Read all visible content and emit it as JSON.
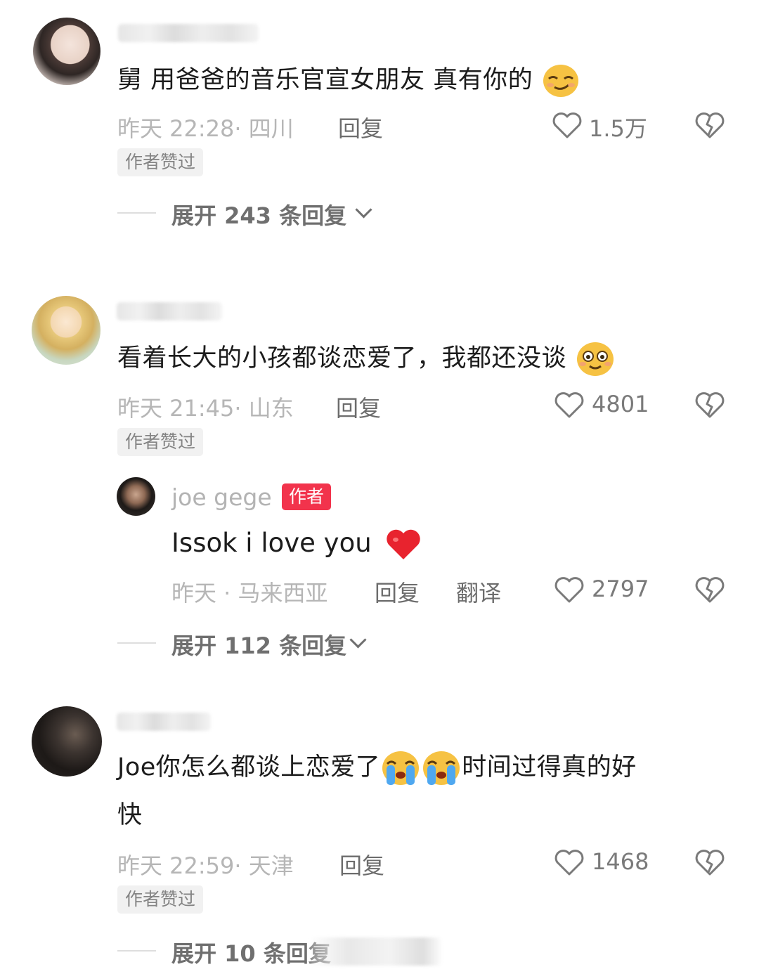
{
  "comments": [
    {
      "text": "舅 用爸爸的音乐官宣女朋友 真有你的",
      "meta": "昨天 22:28· 四川",
      "reply_label": "回复",
      "likes": "1.5万",
      "badge": "作者赞过",
      "expand": "展开 243 条回复",
      "emoji": "smirk-face"
    },
    {
      "text": "看着长大的小孩都谈恋爱了，我都还没谈",
      "meta": "昨天 21:45· 山东",
      "reply_label": "回复",
      "likes": "4801",
      "badge": "作者赞过",
      "emoji": "blushing-face",
      "author_reply": {
        "name": "joe gege",
        "tag": "作者",
        "text": "Issok i love you",
        "meta": "昨天 · 马来西亚",
        "reply_label": "回复",
        "translate_label": "翻译",
        "likes": "2797",
        "emoji": "red-heart"
      },
      "expand": "展开 112 条回复"
    },
    {
      "text_line1_a": "Joe你怎么都谈上恋爱了",
      "text_line1_b": "时间过得真的好",
      "text_line2": "快",
      "meta": "昨天 22:59· 天津",
      "reply_label": "回复",
      "likes": "1468",
      "badge": "作者赞过",
      "expand": "展开 10 条回复",
      "emoji": "crying-face"
    }
  ],
  "colors": {
    "author_badge": "#f2334c",
    "meta_text": "#b6b6b6",
    "background": "#ffffff"
  }
}
